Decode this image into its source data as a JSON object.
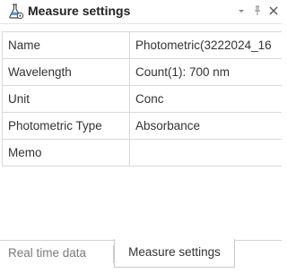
{
  "panel": {
    "title": "Measure settings",
    "icon": "flask-gear-icon",
    "buttons": [
      "dropdown-icon",
      "pin-icon",
      "close-icon"
    ]
  },
  "properties": [
    {
      "name": "Name",
      "value": "Photometric(3222024_16"
    },
    {
      "name": "Wavelength",
      "value": "Count(1): 700 nm"
    },
    {
      "name": "Unit",
      "value": "Conc"
    },
    {
      "name": "Photometric Type",
      "value": "Absorbance"
    },
    {
      "name": "Memo",
      "value": ""
    }
  ],
  "tabs": [
    {
      "label": "Real time data",
      "active": false
    },
    {
      "label": "Measure settings",
      "active": true
    }
  ]
}
